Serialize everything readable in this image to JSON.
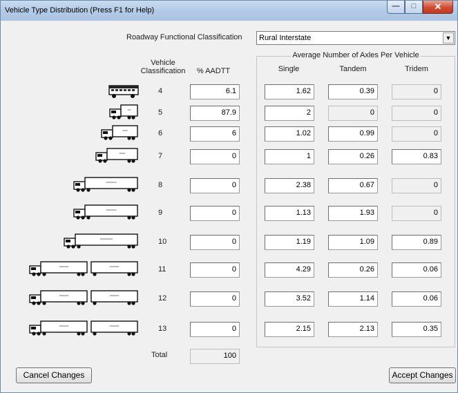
{
  "window": {
    "title": "Vehicle Type Distribution (Press F1 for Help)",
    "buttons": {
      "minimize": "minimize-icon",
      "maximize": "maximize-icon",
      "close": "close-icon"
    }
  },
  "roadway": {
    "label": "Roadway Functional Classification",
    "value": "Rural Interstate"
  },
  "headers": {
    "vehicle_classification_line1": "Vehicle",
    "vehicle_classification_line2": "Classification",
    "aadtt": "% AADTT",
    "axles_group": "Average Number of Axles Per Vehicle",
    "single": "Single",
    "tandem": "Tandem",
    "tridem": "Tridem"
  },
  "rows": [
    {
      "class": "4",
      "aadtt": "6.1",
      "single": "1.62",
      "tandem": "0.39",
      "tridem": "0"
    },
    {
      "class": "5",
      "aadtt": "87.9",
      "single": "2",
      "tandem": "0",
      "tridem": "0"
    },
    {
      "class": "6",
      "aadtt": "6",
      "single": "1.02",
      "tandem": "0.99",
      "tridem": "0"
    },
    {
      "class": "7",
      "aadtt": "0",
      "single": "1",
      "tandem": "0.26",
      "tridem": "0.83"
    },
    {
      "class": "8",
      "aadtt": "0",
      "single": "2.38",
      "tandem": "0.67",
      "tridem": "0"
    },
    {
      "class": "9",
      "aadtt": "0",
      "single": "1.13",
      "tandem": "1.93",
      "tridem": "0"
    },
    {
      "class": "10",
      "aadtt": "0",
      "single": "1.19",
      "tandem": "1.09",
      "tridem": "0.89"
    },
    {
      "class": "11",
      "aadtt": "0",
      "single": "4.29",
      "tandem": "0.26",
      "tridem": "0.06"
    },
    {
      "class": "12",
      "aadtt": "0",
      "single": "3.52",
      "tandem": "1.14",
      "tridem": "0.06"
    },
    {
      "class": "13",
      "aadtt": "0",
      "single": "2.15",
      "tandem": "2.13",
      "tridem": "0.35"
    }
  ],
  "total": {
    "label": "Total",
    "value": "100"
  },
  "actions": {
    "cancel": "Cancel Changes",
    "accept": "Accept Changes"
  }
}
